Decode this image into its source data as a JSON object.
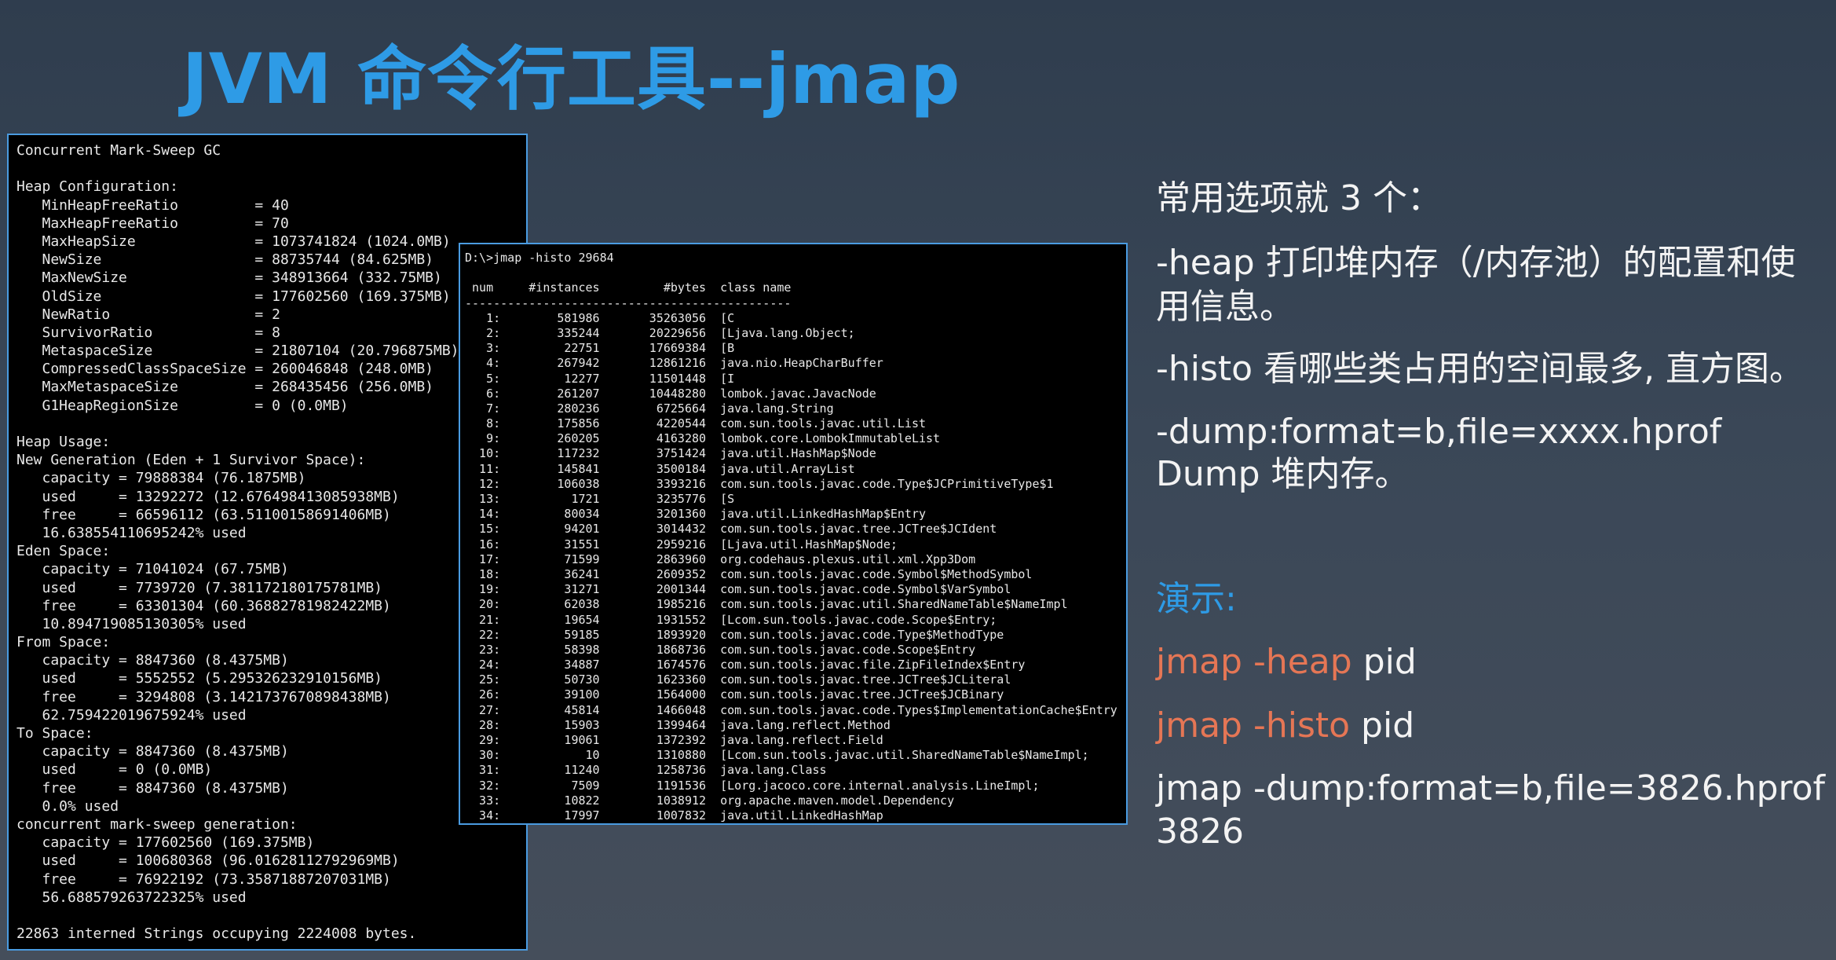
{
  "title": "JVM 命令行工具--jmap",
  "heap_terminal": {
    "lines": [
      "Concurrent Mark-Sweep GC",
      "",
      "Heap Configuration:",
      "   MinHeapFreeRatio         = 40",
      "   MaxHeapFreeRatio         = 70",
      "   MaxHeapSize              = 1073741824 (1024.0MB)",
      "   NewSize                  = 88735744 (84.625MB)",
      "   MaxNewSize               = 348913664 (332.75MB)",
      "   OldSize                  = 177602560 (169.375MB)",
      "   NewRatio                 = 2",
      "   SurvivorRatio            = 8",
      "   MetaspaceSize            = 21807104 (20.796875MB)",
      "   CompressedClassSpaceSize = 260046848 (248.0MB)",
      "   MaxMetaspaceSize         = 268435456 (256.0MB)",
      "   G1HeapRegionSize         = 0 (0.0MB)",
      "",
      "Heap Usage:",
      "New Generation (Eden + 1 Survivor Space):",
      "   capacity = 79888384 (76.1875MB)",
      "   used     = 13292272 (12.676498413085938MB)",
      "   free     = 66596112 (63.51100158691406MB)",
      "   16.638554110695242% used",
      "Eden Space:",
      "   capacity = 71041024 (67.75MB)",
      "   used     = 7739720 (7.381172180175781MB)",
      "   free     = 63301304 (60.36882781982422MB)",
      "   10.894719085130305% used",
      "From Space:",
      "   capacity = 8847360 (8.4375MB)",
      "   used     = 5552552 (5.295326232910156MB)",
      "   free     = 3294808 (3.1421737670898438MB)",
      "   62.759422019675924% used",
      "To Space:",
      "   capacity = 8847360 (8.4375MB)",
      "   used     = 0 (0.0MB)",
      "   free     = 8847360 (8.4375MB)",
      "   0.0% used",
      "concurrent mark-sweep generation:",
      "   capacity = 177602560 (169.375MB)",
      "   used     = 100680368 (96.01628112792969MB)",
      "   free     = 76922192 (73.35871887207031MB)",
      "   56.688579263722325% used",
      "",
      "22863 interned Strings occupying 2224008 bytes."
    ]
  },
  "histo_terminal": {
    "command": "D:\\>jmap -histo 29684",
    "header": " num     #instances         #bytes  class name",
    "separator": "----------------------------------------------",
    "rows": [
      "   1:        581986       35263056  [C",
      "   2:        335244       20229656  [Ljava.lang.Object;",
      "   3:         22751       17669384  [B",
      "   4:        267942       12861216  java.nio.HeapCharBuffer",
      "   5:         12277       11501448  [I",
      "   6:        261207       10448280  lombok.javac.JavacNode",
      "   7:        280236        6725664  java.lang.String",
      "   8:        175856        4220544  com.sun.tools.javac.util.List",
      "   9:        260205        4163280  lombok.core.LombokImmutableList",
      "  10:        117232        3751424  java.util.HashMap$Node",
      "  11:        145841        3500184  java.util.ArrayList",
      "  12:        106038        3393216  com.sun.tools.javac.code.Type$JCPrimitiveType$1",
      "  13:          1721        3235776  [S",
      "  14:         80034        3201360  java.util.LinkedHashMap$Entry",
      "  15:         94201        3014432  com.sun.tools.javac.tree.JCTree$JCIdent",
      "  16:         31551        2959216  [Ljava.util.HashMap$Node;",
      "  17:         71599        2863960  org.codehaus.plexus.util.xml.Xpp3Dom",
      "  18:         36241        2609352  com.sun.tools.javac.code.Symbol$MethodSymbol",
      "  19:         31271        2001344  com.sun.tools.javac.code.Symbol$VarSymbol",
      "  20:         62038        1985216  com.sun.tools.javac.util.SharedNameTable$NameImpl",
      "  21:         19654        1931552  [Lcom.sun.tools.javac.code.Scope$Entry;",
      "  22:         59185        1893920  com.sun.tools.javac.code.Type$MethodType",
      "  23:         58398        1868736  com.sun.tools.javac.code.Scope$Entry",
      "  24:         34887        1674576  com.sun.tools.javac.file.ZipFileIndex$Entry",
      "  25:         50730        1623360  com.sun.tools.javac.tree.JCTree$JCLiteral",
      "  26:         39100        1564000  com.sun.tools.javac.tree.JCTree$JCBinary",
      "  27:         45814        1466048  com.sun.tools.javac.code.Types$ImplementationCache$Entry",
      "  28:         15903        1399464  java.lang.reflect.Method",
      "  29:         19061        1372392  java.lang.reflect.Field",
      "  30:            10        1310880  [Lcom.sun.tools.javac.util.SharedNameTable$NameImpl;",
      "  31:         11240        1258736  java.lang.Class",
      "  32:          7509        1191536  [Lorg.jacoco.core.internal.analysis.LineImpl;",
      "  33:         10822        1038912  org.apache.maven.model.Dependency",
      "  34:         17997        1007832  java.util.LinkedHashMap"
    ]
  },
  "notes": {
    "intro": "常用选项就 3 个：",
    "heap": "-heap 打印堆内存（/内存池）的配置和使用信息。",
    "histo": "-histo 看哪些类占用的空间最多, 直方图。",
    "dump_line1": "-dump:format=b,file=xxxx.hprof",
    "dump_line2": "Dump 堆内存。"
  },
  "demo": {
    "label": "演示:",
    "heap_cmd": "jmap -heap",
    "heap_arg": " pid",
    "histo_cmd": "jmap -histo",
    "histo_arg": " pid",
    "dump_line1": "jmap -dump:format=b,file=3826.hprof",
    "dump_line2": "3826"
  },
  "colors": {
    "title": "#2e9be6",
    "demo_label": "#2e9be6",
    "command_highlight": "#e57655",
    "terminal_border": "#4a9be0"
  }
}
